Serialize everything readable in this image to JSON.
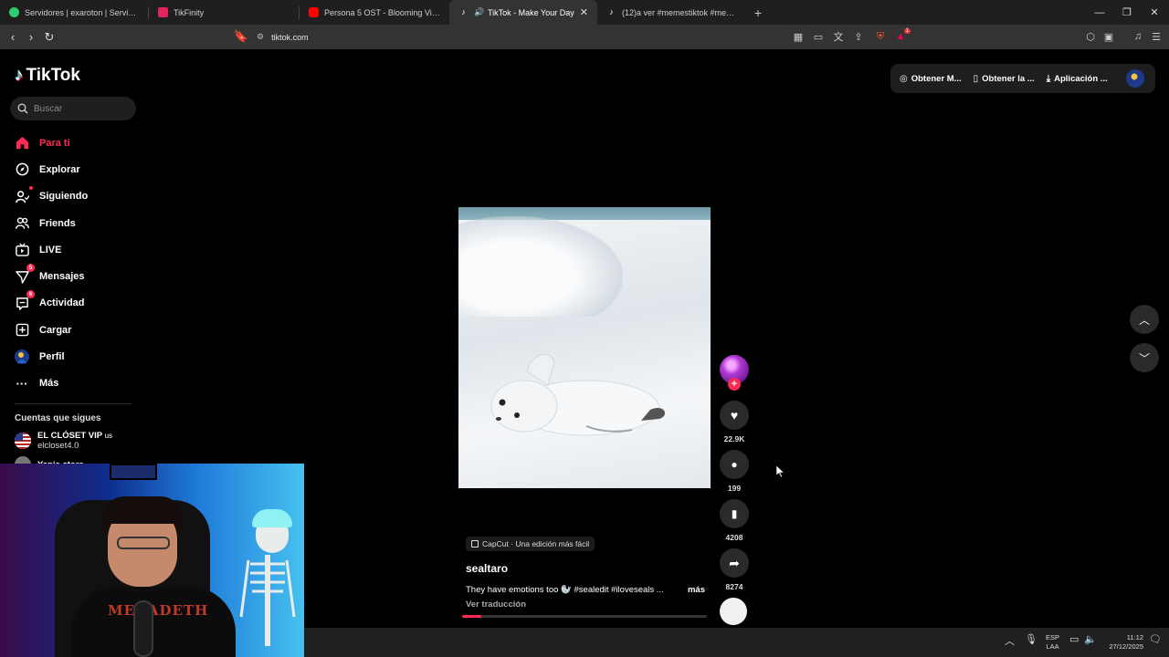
{
  "browser": {
    "tabs": [
      {
        "title": "Servidores | exaroton | Servidores de",
        "color": "#2ecc71",
        "active": false
      },
      {
        "title": "TikFinity",
        "color": "#e0245e",
        "active": false
      },
      {
        "title": "Persona 5 OST - Blooming Villain [Ext",
        "color": "#ff0000",
        "active": false
      },
      {
        "title": "TikTok - Make Your Day",
        "color": "#25f4ee",
        "active": true
      },
      {
        "title": "(12)a ver #memestiktok #memesene",
        "color": "#25f4ee",
        "active": false
      }
    ],
    "url": "tiktok.com",
    "extension_badge": "1"
  },
  "tiktok": {
    "logo": "TikTok",
    "search_placeholder": "Buscar",
    "nav": [
      {
        "label": "Para ti",
        "icon": "home-icon",
        "active": true
      },
      {
        "label": "Explorar",
        "icon": "compass-icon"
      },
      {
        "label": "Siguiendo",
        "icon": "following-icon",
        "dot": true
      },
      {
        "label": "Friends",
        "icon": "friends-icon"
      },
      {
        "label": "LIVE",
        "icon": "live-icon"
      },
      {
        "label": "Mensajes",
        "icon": "messages-icon",
        "badge": "5"
      },
      {
        "label": "Actividad",
        "icon": "activity-icon",
        "badge": "6"
      },
      {
        "label": "Cargar",
        "icon": "upload-icon"
      },
      {
        "label": "Perfil",
        "icon": "profile-icon"
      },
      {
        "label": "Más",
        "icon": "more-icon"
      }
    ],
    "following_title": "Cuentas que sigues",
    "following": [
      {
        "name": "EL CLÓSET VIP",
        "flag": "us",
        "handle": "elcloset4.0"
      },
      {
        "name": "Yanis store",
        "handle": ""
      }
    ],
    "top_actions": [
      {
        "label": "Obtener M...",
        "icon": "coin-icon"
      },
      {
        "label": "Obtener la ...",
        "icon": "phone-icon"
      },
      {
        "label": "Aplicación ...",
        "icon": "download-icon"
      }
    ],
    "video": {
      "sponsor": "CapCut · Una edición más fácil",
      "author": "sealtaro",
      "description": "They have emotions too 🦭 #sealedit #iloveseals ...",
      "more": "más",
      "translate": "Ver traducción",
      "progress": 0.08,
      "likes": "22.9K",
      "comments": "199",
      "saves": "4208",
      "shares": "8274"
    }
  },
  "webcam": {
    "shirt_text": "MEGADETH"
  },
  "taskbar": {
    "lang_line1": "ESP",
    "lang_line2": "LAA",
    "time": "11:12",
    "date": "27/12/2025"
  },
  "colors": {
    "accent": "#fe2c55",
    "background": "#000000",
    "chrome": "#333333"
  }
}
